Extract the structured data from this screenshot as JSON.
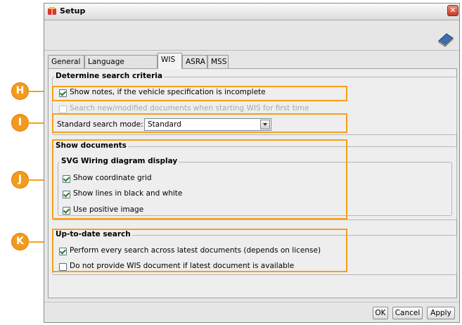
{
  "window": {
    "title": "Setup",
    "close_glyph": "✕"
  },
  "tabs": [
    {
      "label": "General"
    },
    {
      "label": "Language selection"
    },
    {
      "label": "WIS"
    },
    {
      "label": "ASRA"
    },
    {
      "label": "MSS"
    }
  ],
  "active_tab": "WIS",
  "search_criteria": {
    "title": "Determine search criteria",
    "show_notes": {
      "label": "Show notes, if the vehicle specification is incomplete",
      "checked": true
    },
    "search_new": {
      "label": "Search new/modified documents when starting WIS for first time",
      "checked": false,
      "disabled": true
    },
    "mode_label": "Standard search mode:",
    "mode_value": "Standard"
  },
  "show_documents": {
    "title": "Show documents",
    "svg_group": {
      "title": "SVG Wiring diagram display",
      "items": [
        {
          "label": "Show coordinate grid",
          "checked": true
        },
        {
          "label": "Show lines in black and white",
          "checked": true
        },
        {
          "label": "Use positive image",
          "checked": true
        }
      ]
    }
  },
  "up_to_date": {
    "title": "Up-to-date search",
    "items": [
      {
        "label": "Perform every search across latest documents (depends on license)",
        "checked": true
      },
      {
        "label": "Do not provide WIS document if latest document is available",
        "checked": false
      }
    ]
  },
  "buttons": {
    "ok": "OK",
    "cancel": "Cancel",
    "apply": "Apply"
  },
  "callouts": [
    "H",
    "I",
    "J",
    "K"
  ],
  "colors": {
    "callout": "#f39a1e",
    "highlight_border": "#f5a01a"
  }
}
